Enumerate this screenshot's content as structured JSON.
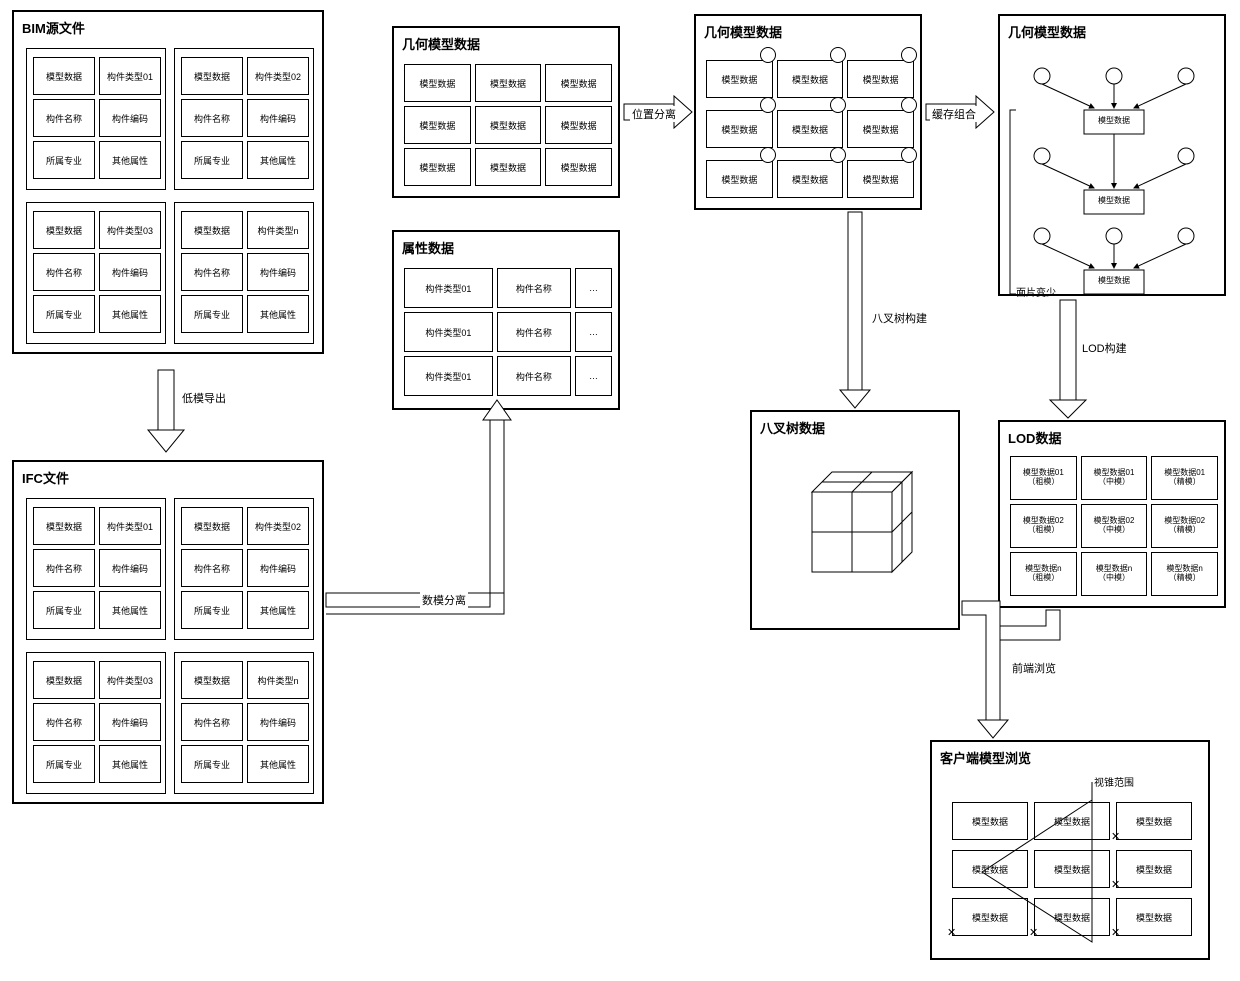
{
  "boxes": {
    "bim": {
      "title": "BIM源文件",
      "panel_cells": [
        "模型数据",
        "构件类型01",
        "构件名称",
        "构件编码",
        "所属专业",
        "其他属性"
      ],
      "panel_cells2": [
        "模型数据",
        "构件类型02",
        "构件名称",
        "构件编码",
        "所属专业",
        "其他属性"
      ],
      "panel_cells3": [
        "模型数据",
        "构件类型03",
        "构件名称",
        "构件编码",
        "所属专业",
        "其他属性"
      ],
      "panel_cells4": [
        "模型数据",
        "构件类型n",
        "构件名称",
        "构件编码",
        "所属专业",
        "其他属性"
      ]
    },
    "ifc": {
      "title": "IFC文件",
      "panel_cells": [
        "模型数据",
        "构件类型01",
        "构件名称",
        "构件编码",
        "所属专业",
        "其他属性"
      ],
      "panel_cells2": [
        "模型数据",
        "构件类型02",
        "构件名称",
        "构件编码",
        "所属专业",
        "其他属性"
      ],
      "panel_cells3": [
        "模型数据",
        "构件类型03",
        "构件名称",
        "构件编码",
        "所属专业",
        "其他属性"
      ],
      "panel_cells4": [
        "模型数据",
        "构件类型n",
        "构件名称",
        "构件编码",
        "所属专业",
        "其他属性"
      ]
    },
    "geo1": {
      "title": "几何模型数据",
      "cells": [
        "模型数据",
        "模型数据",
        "模型数据",
        "模型数据",
        "模型数据",
        "模型数据",
        "模型数据",
        "模型数据",
        "模型数据"
      ]
    },
    "attr": {
      "title": "属性数据",
      "rows": [
        [
          "构件类型01",
          "构件名称",
          "…"
        ],
        [
          "构件类型01",
          "构件名称",
          "…"
        ],
        [
          "构件类型01",
          "构件名称",
          "…"
        ]
      ]
    },
    "geo2": {
      "title": "几何模型数据",
      "cells": [
        "模型数据",
        "模型数据",
        "模型数据",
        "模型数据",
        "模型数据",
        "模型数据",
        "模型数据",
        "模型数据",
        "模型数据"
      ]
    },
    "geo3": {
      "title": "几何模型数据",
      "node": "模型数据",
      "note": "面片变少"
    },
    "octree": {
      "title": "八叉树数据"
    },
    "lod": {
      "title": "LOD数据",
      "cells": [
        "模型数据01\n（粗模）",
        "模型数据01\n（中模）",
        "模型数据01\n（精模）",
        "模型数据02\n（粗模）",
        "模型数据02\n（中模）",
        "模型数据02\n（精模）",
        "模型数据n\n（粗模）",
        "模型数据n\n（中模）",
        "模型数据n\n（精模）"
      ]
    },
    "client": {
      "title": "客户端模型浏览",
      "frustum_label": "视锥范围",
      "cells": [
        "模型数据",
        "模型数据",
        "模型数据",
        "模型数据",
        "模型数据",
        "模型数据",
        "模型数据",
        "模型数据",
        "模型数据"
      ]
    }
  },
  "arrows": {
    "low_export": "低模导出",
    "data_sep": "数模分离",
    "pos_sep": "位置分离",
    "cache_combine": "缓存组合",
    "octree_build": "八叉树构建",
    "lod_build": "LOD构建",
    "frontend_view": "前端浏览"
  }
}
